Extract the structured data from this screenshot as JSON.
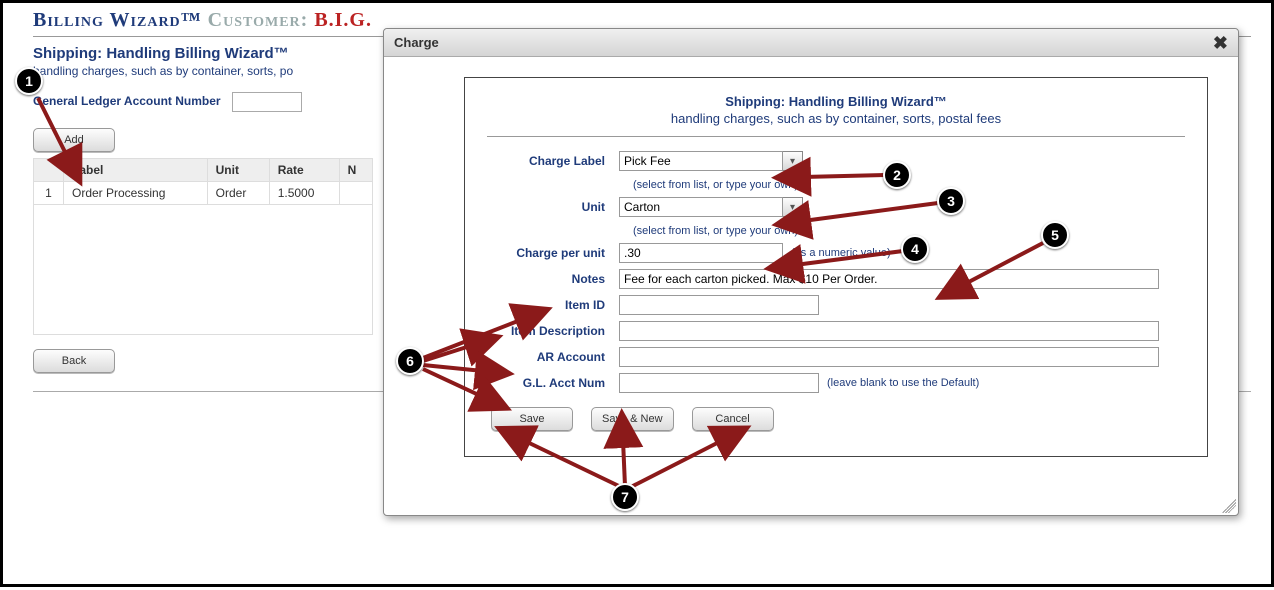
{
  "header": {
    "app_title": "Billing Wizard™",
    "customer_label": "Customer:",
    "customer_name": "B.I.G."
  },
  "shipping": {
    "title": "Shipping: Handling Billing Wizard™",
    "desc_prefix": "handling charges, such as by container, sorts, po"
  },
  "gl": {
    "label": "General Ledger Account Number",
    "value": ""
  },
  "buttons": {
    "add": "Add",
    "back": "Back"
  },
  "grid": {
    "cols": {
      "label": "Label",
      "unit": "Unit",
      "rate": "Rate",
      "notes_abbrev": "N"
    },
    "rows": [
      {
        "id": "1",
        "label": "Order Processing",
        "unit": "Order",
        "rate": "1.5000"
      }
    ]
  },
  "modal": {
    "title": "Charge",
    "heading": "Shipping: Handling Billing Wizard™",
    "subheading": "handling charges, such as by container, sorts, postal fees",
    "labels": {
      "charge_label": "Charge Label",
      "unit": "Unit",
      "charge_per_unit": "Charge per unit",
      "notes": "Notes",
      "item_id": "Item ID",
      "item_desc": "Item Description",
      "ar_account": "AR Account",
      "gl_acct": "G.L. Acct Num"
    },
    "values": {
      "charge_label": "Pick Fee",
      "unit": "Carton",
      "charge_per_unit": ".30",
      "notes": "Fee for each carton picked. Max $10 Per Order.",
      "item_id": "",
      "item_desc": "",
      "ar_account": "",
      "gl_acct": ""
    },
    "hints": {
      "select_or_type": "(select from list, or type your own)",
      "numeric": "(as a numeric value)",
      "gl_default": "(leave blank to use the Default)"
    },
    "buttons": {
      "save": "Save",
      "save_new": "Save & New",
      "cancel": "Cancel"
    }
  },
  "annotations": {
    "b1": "1",
    "b2": "2",
    "b3": "3",
    "b4": "4",
    "b5": "5",
    "b6": "6",
    "b7": "7"
  }
}
